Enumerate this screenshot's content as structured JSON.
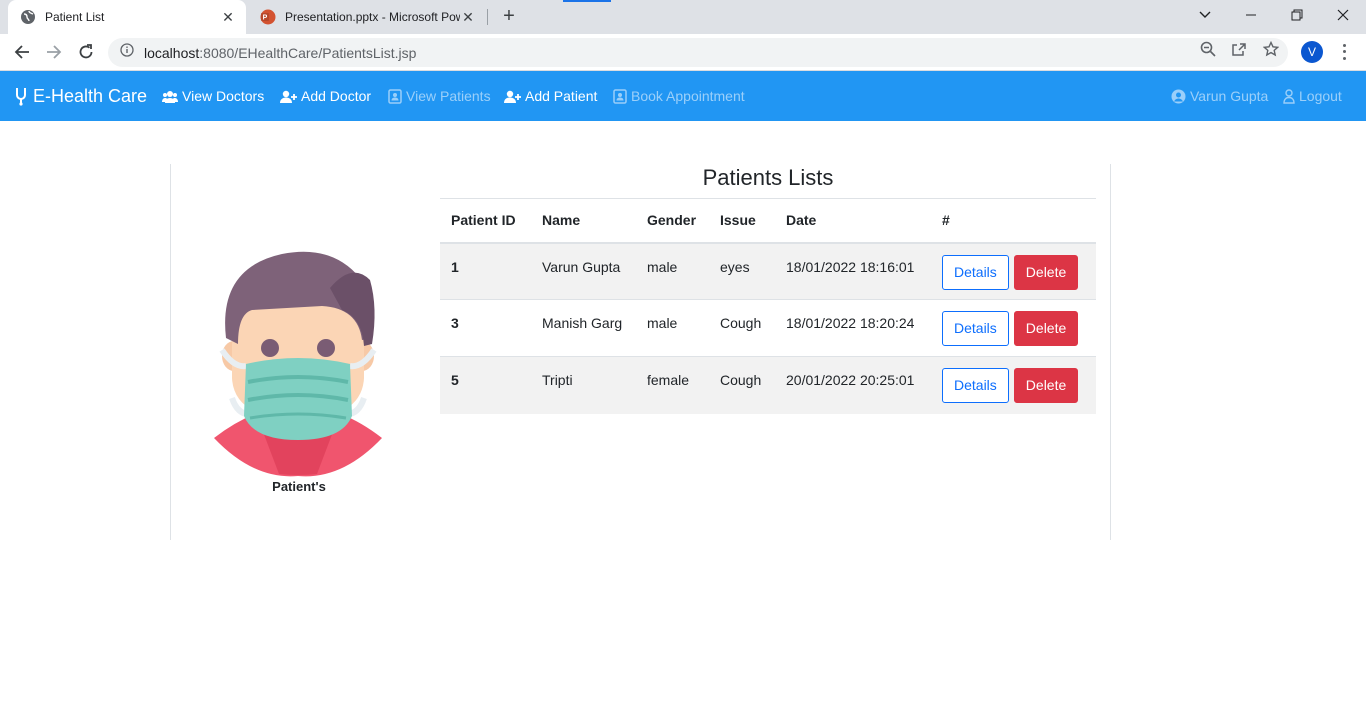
{
  "browser": {
    "tabs": [
      {
        "title": "Patient List",
        "active": true
      },
      {
        "title": "Presentation.pptx - Microsoft PowerPoint",
        "active": false
      }
    ],
    "url_host": "localhost",
    "url_rest": ":8080/EHealthCare/PatientsList.jsp",
    "profile_initial": "V"
  },
  "navbar": {
    "brand": "E-Health Care",
    "links": [
      {
        "label": "View Doctors",
        "icon": "users-icon"
      },
      {
        "label": "Add Doctor",
        "icon": "user-plus-icon"
      },
      {
        "label": "View Patients",
        "icon": "id-card-icon"
      },
      {
        "label": "Add Patient",
        "icon": "user-plus-icon"
      },
      {
        "label": "Book Appointment",
        "icon": "id-card-icon"
      }
    ],
    "user": "Varun Gupta",
    "logout": "Logout",
    "color": "#2196f3"
  },
  "sidebar": {
    "image_label": "Patient's"
  },
  "patients_table": {
    "title": "Patients Lists",
    "headers": [
      "Patient ID",
      "Name",
      "Gender",
      "Issue",
      "Date",
      "#"
    ],
    "rows": [
      {
        "id": "1",
        "name": "Varun Gupta",
        "gender": "male",
        "issue": "eyes",
        "date": "18/01/2022 18:16:01"
      },
      {
        "id": "3",
        "name": "Manish Garg",
        "gender": "male",
        "issue": "Cough",
        "date": "18/01/2022 18:20:24"
      },
      {
        "id": "5",
        "name": "Tripti",
        "gender": "female",
        "issue": "Cough",
        "date": "20/01/2022 20:25:01"
      }
    ],
    "details_label": "Details",
    "delete_label": "Delete"
  }
}
